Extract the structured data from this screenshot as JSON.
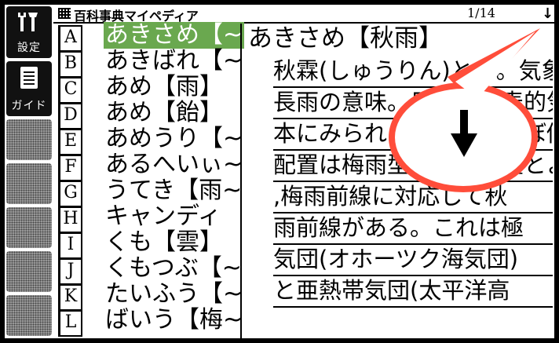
{
  "titlebar": {
    "title": "百科事典マイペディア",
    "page_indicator": "1/14"
  },
  "sidebar": {
    "settings_label": "設定",
    "guide_label": "ガイド"
  },
  "list": [
    {
      "key": "A",
      "word": "あきさめ【~",
      "selected": true
    },
    {
      "key": "B",
      "word": "あきばれ【~",
      "selected": false
    },
    {
      "key": "C",
      "word": "あめ【雨】",
      "selected": false
    },
    {
      "key": "D",
      "word": "あめ【飴】",
      "selected": false
    },
    {
      "key": "E",
      "word": "あめうり【~",
      "selected": false
    },
    {
      "key": "F",
      "word": "あるへいぃ~",
      "selected": false
    },
    {
      "key": "G",
      "word": "うてき【雨~",
      "selected": false
    },
    {
      "key": "H",
      "word": "キャンディ",
      "selected": false
    },
    {
      "key": "I",
      "word": "くも【雲】",
      "selected": false
    },
    {
      "key": "J",
      "word": "くもつぶ【~",
      "selected": false
    },
    {
      "key": "K",
      "word": "たいふう【~",
      "selected": false
    },
    {
      "key": "L",
      "word": "ばいう【梅~",
      "selected": false
    }
  ],
  "content": {
    "heading": "あきさめ【秋雨】",
    "lines": [
      "秋霖(しゅうりん)とも。気象上は",
      "長雨の意味。日本の代表的気団",
      "本にみられる。梅雨とほぼ似た",
      "配置は梅雨型の気圧配置とよばり",
      ",梅雨前線に対応して秋",
      "雨前線がある。これは極",
      "気団(オホーツク海気団)",
      "と亜熱帯気団(太平洋高"
    ]
  },
  "colors": {
    "selection": "#6aa84f",
    "callout": "#ff4d3a"
  },
  "icons": {
    "settings": "tools-icon",
    "guide": "document-icon",
    "scroll": "arrow-down-icon"
  }
}
